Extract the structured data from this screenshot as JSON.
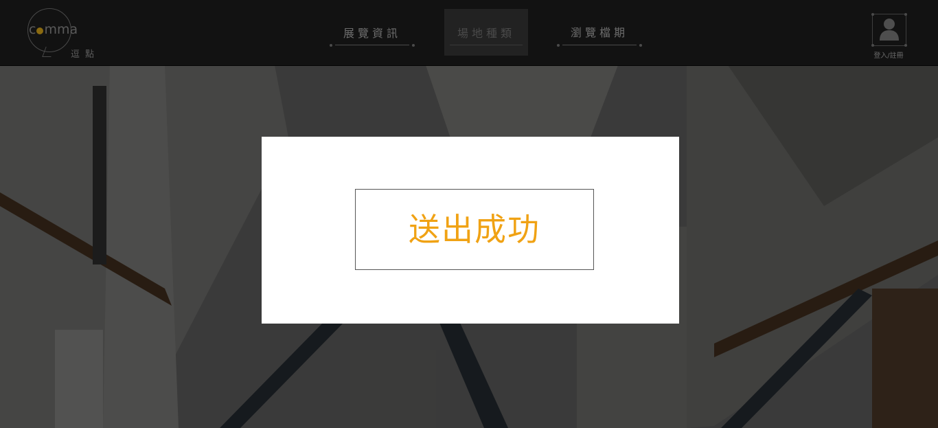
{
  "header": {
    "logo": {
      "word": "comma",
      "sub": "逗點"
    },
    "nav": [
      {
        "label": "展覽資訊",
        "active": false
      },
      {
        "label": "場地種類",
        "active": true
      },
      {
        "label": "瀏覽檔期",
        "active": false
      }
    ],
    "user": {
      "icon": "user-icon",
      "label": "登入/註冊"
    }
  },
  "modal": {
    "message": "送出成功"
  },
  "colors": {
    "accent": "#f0a214",
    "header_bg": "#121212",
    "overlay": "rgba(0,0,0,0.62)"
  }
}
